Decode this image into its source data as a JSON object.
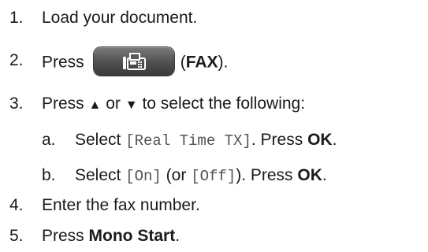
{
  "steps": [
    {
      "number": "1.",
      "text": "Load your document."
    },
    {
      "number": "2.",
      "pre": "Press",
      "button_icon": "fax-icon",
      "open_paren": "(",
      "bold": "FAX",
      "close": ")."
    },
    {
      "number": "3.",
      "pre": "Press",
      "up": "▲",
      "mid": "or",
      "down": "▼",
      "post": "to select the following:"
    },
    {
      "number": "4.",
      "text": "Enter the fax number."
    },
    {
      "number": "5.",
      "pre": "Press",
      "bold": "Mono Start",
      "post": "."
    }
  ],
  "substeps": [
    {
      "letter": "a.",
      "pre": "Select",
      "code1": "[Real Time TX]",
      "mid": ". Press",
      "bold": "OK",
      "post": "."
    },
    {
      "letter": "b.",
      "pre": "Select",
      "code1": "[On]",
      "open": "(or",
      "code2": "[Off]",
      "mid": "). Press",
      "bold": "OK",
      "post": "."
    }
  ],
  "colors": {
    "button_dark": "#4f4f4f",
    "text": "#1a1a1a"
  }
}
